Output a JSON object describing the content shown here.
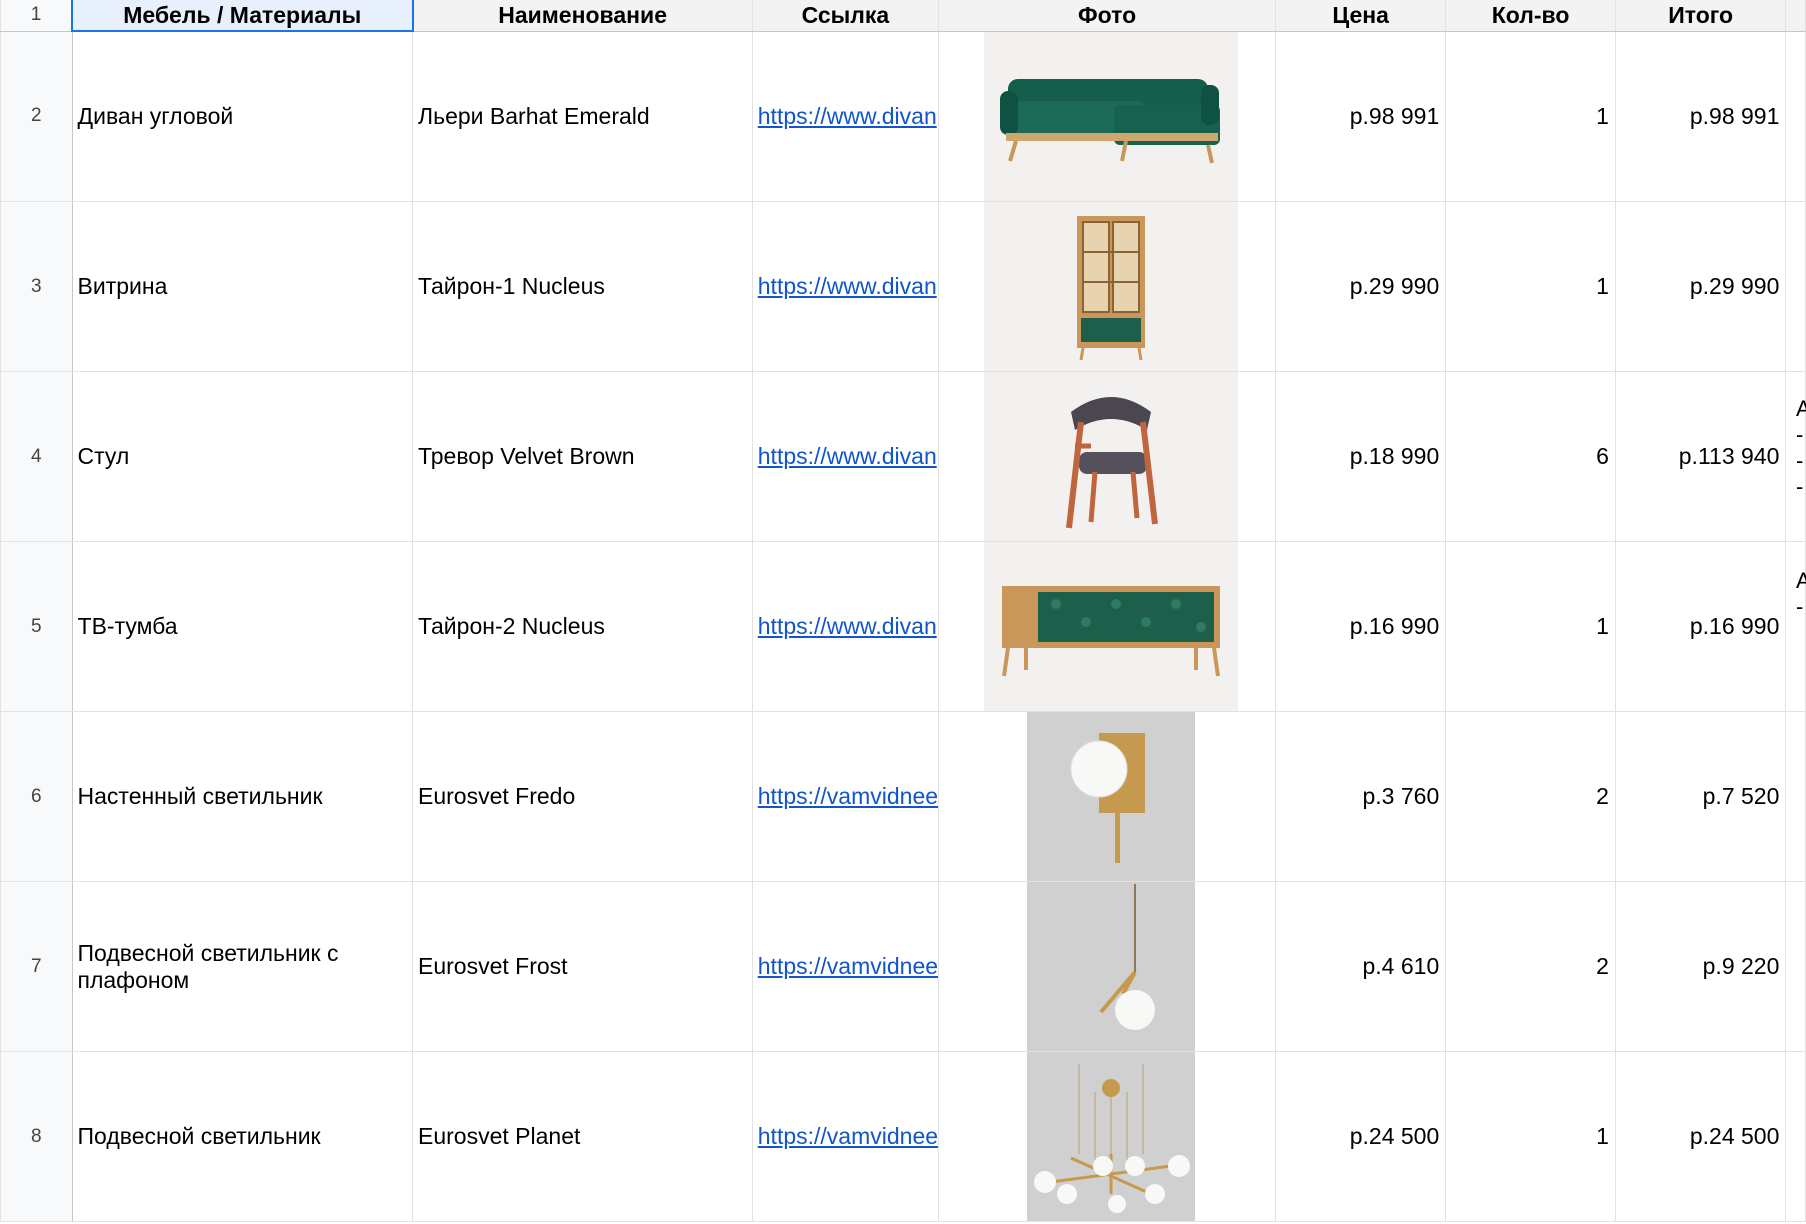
{
  "columns": {
    "category": "Мебель / Материалы",
    "name": "Наименование",
    "link": "Ссылка",
    "photo": "Фото",
    "price": "Цена",
    "qty": "Кол-во",
    "total": "Итого"
  },
  "header_row_number": "1",
  "rows": [
    {
      "num": "2",
      "category": "Диван угловой",
      "name": "Льери Barhat Emerald",
      "link": "https://www.divan",
      "photo_icon": "sofa-photo",
      "price": "р.98 991",
      "qty": "1",
      "total": "р.98 991"
    },
    {
      "num": "3",
      "category": "Витрина",
      "name": "Тайрон-1 Nucleus",
      "link": "https://www.divan",
      "photo_icon": "showcase-photo",
      "price": "р.29 990",
      "qty": "1",
      "total": "р.29 990"
    },
    {
      "num": "4",
      "category": "Стул",
      "name": "Тревор Velvet Brown",
      "link": "https://www.divan",
      "photo_icon": "chair-photo",
      "price": "р.18 990",
      "qty": "6",
      "total": "р.113 940"
    },
    {
      "num": "5",
      "category": "ТВ-тумба",
      "name": "Тайрон-2 Nucleus",
      "link": "https://www.divan",
      "photo_icon": "tv-stand-photo",
      "price": "р.16 990",
      "qty": "1",
      "total": "р.16 990"
    },
    {
      "num": "6",
      "category": "Настенный светильник",
      "name": "Eurosvet Fredo",
      "link": "https://vamvidnee",
      "photo_icon": "wall-lamp-photo",
      "price": "р.3 760",
      "qty": "2",
      "total": "р.7 520"
    },
    {
      "num": "7",
      "category": "Подвесной светильник с плафоном",
      "name": "Eurosvet Frost",
      "link": "https://vamvidnee",
      "photo_icon": "pendant-lamp-photo",
      "price": "р.4 610",
      "qty": "2",
      "total": "р.9 220"
    },
    {
      "num": "8",
      "category": "Подвесной светильник",
      "name": "Eurosvet Planet",
      "link": "https://vamvidnee",
      "photo_icon": "chandelier-photo",
      "price": "р.24 500",
      "qty": "1",
      "total": "р.24 500"
    }
  ],
  "overflow_text": {
    "row4": "А\n-\n-\n-",
    "row5": "А\n-"
  },
  "colors": {
    "link": "#1155cc",
    "selection": "#1a73e8",
    "grid": "#e2e2e2",
    "sofa_green": "#155e4c",
    "wood": "#c9975a",
    "brass": "#c59a4e"
  }
}
